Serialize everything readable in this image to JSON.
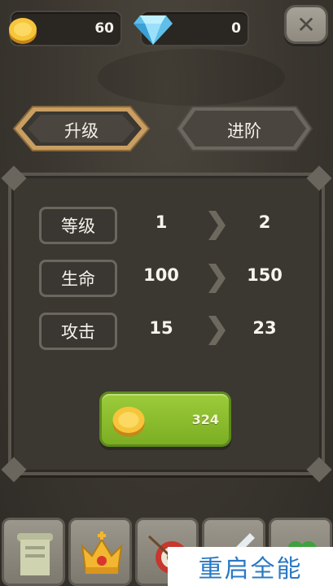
{
  "currency": {
    "coins": "60",
    "gems": "0"
  },
  "tabs": [
    {
      "label": "升级",
      "active": true
    },
    {
      "label": "进阶",
      "active": false
    }
  ],
  "stats": [
    {
      "label": "等级",
      "current": "1",
      "next": "2"
    },
    {
      "label": "生命",
      "current": "100",
      "next": "150"
    },
    {
      "label": "攻击",
      "current": "15",
      "next": "23"
    }
  ],
  "upgrade_cost": "324",
  "bottom_nav": [
    {
      "icon": "scroll-icon"
    },
    {
      "icon": "crown-icon"
    },
    {
      "icon": "target-icon"
    },
    {
      "icon": "sword-icon"
    },
    {
      "icon": "clover-icon"
    }
  ],
  "watermark": "重启全能",
  "colors": {
    "background": "#3a362f",
    "accent_gold": "#c79b5c",
    "buy_green": "#8cbf2e",
    "coin": "#f4c23a",
    "gem": "#7fd3f5"
  }
}
